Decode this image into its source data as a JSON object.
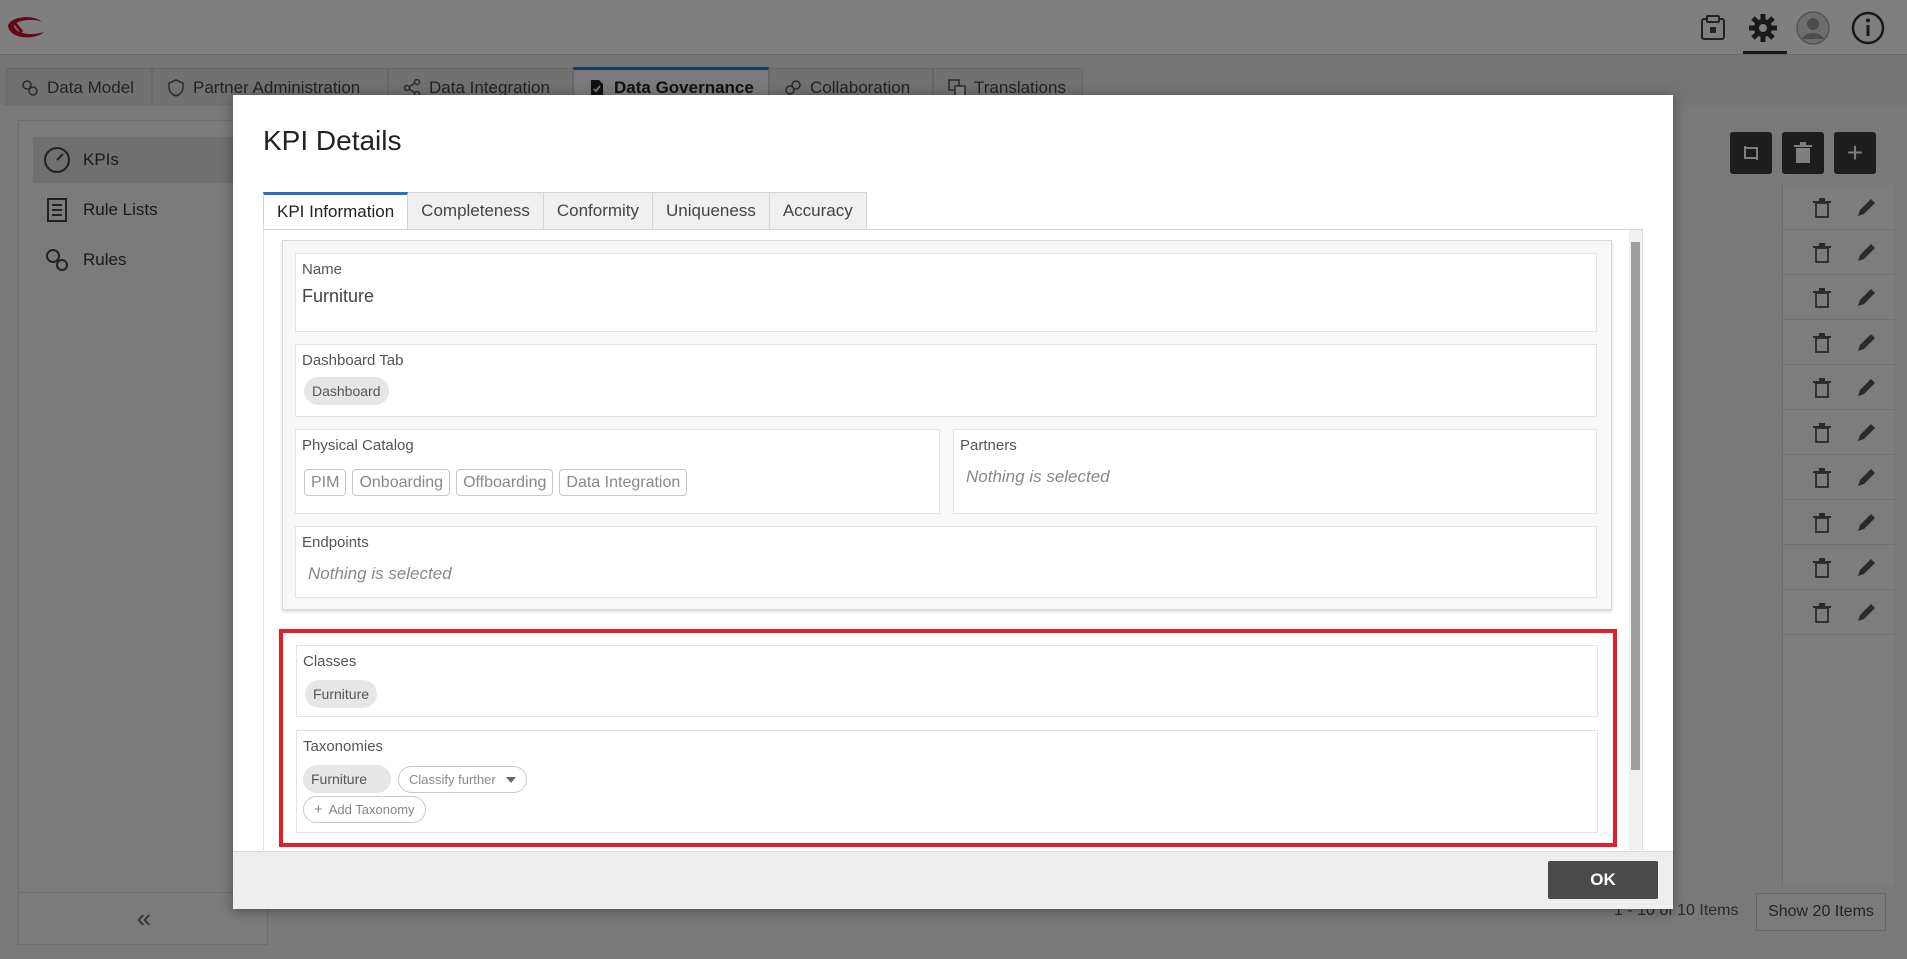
{
  "app": {
    "main_tabs": [
      {
        "label": "Data Model"
      },
      {
        "label": "Partner Administration"
      },
      {
        "label": "Data Integration"
      },
      {
        "label": "Data Governance"
      },
      {
        "label": "Collaboration"
      },
      {
        "label": "Translations"
      }
    ],
    "active_tab": "Data Governance",
    "sidebar": {
      "items": [
        {
          "label": "KPIs"
        },
        {
          "label": "Rule Lists"
        },
        {
          "label": "Rules"
        }
      ],
      "active": "KPIs"
    },
    "pager": {
      "range_text": "1 - 10 of 10 Items",
      "show_button": "Show 20 Items"
    },
    "grid_rows": 10
  },
  "modal": {
    "title": "KPI Details",
    "tabs": [
      {
        "label": "KPI Information"
      },
      {
        "label": "Completeness"
      },
      {
        "label": "Conformity"
      },
      {
        "label": "Uniqueness"
      },
      {
        "label": "Accuracy"
      }
    ],
    "active_tab": "KPI Information",
    "fields": {
      "name": {
        "label": "Name",
        "value": "Furniture"
      },
      "dashboard_tab": {
        "label": "Dashboard Tab",
        "value": "Dashboard"
      },
      "physical_catalog": {
        "label": "Physical Catalog",
        "options": [
          "PIM",
          "Onboarding",
          "Offboarding",
          "Data Integration"
        ]
      },
      "partners": {
        "label": "Partners",
        "empty": "Nothing is selected"
      },
      "endpoints": {
        "label": "Endpoints",
        "empty": "Nothing is selected"
      },
      "classes": {
        "label": "Classes",
        "value": "Furniture"
      },
      "taxonomies": {
        "label": "Taxonomies",
        "value": "Furniture",
        "classify_further": "Classify further",
        "add_taxonomy": "Add Taxonomy"
      }
    },
    "ok_label": "OK"
  },
  "colors": {
    "accent": "#2a6fc4",
    "highlight": "#e3202a",
    "logo": "#c8102e",
    "button_dark": "#4a4a4a"
  }
}
